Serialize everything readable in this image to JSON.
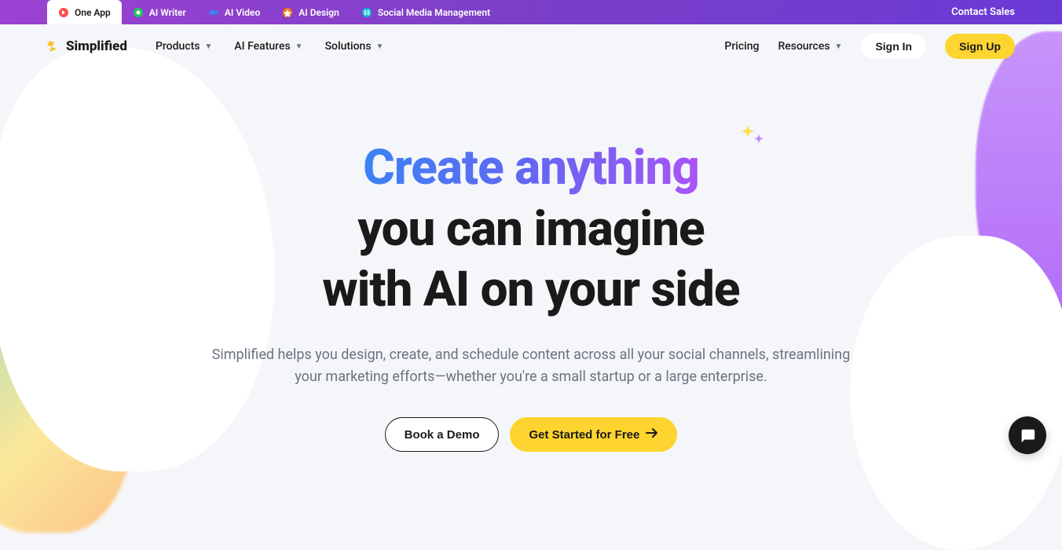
{
  "topBar": {
    "tabs": [
      {
        "icon": "oneapp",
        "label": "One App",
        "color": "#ff4d4d"
      },
      {
        "icon": "writer",
        "label": "AI Writer",
        "color": "#22c55e"
      },
      {
        "icon": "video",
        "label": "AI Video",
        "color": "#3b82f6"
      },
      {
        "icon": "design",
        "label": "AI Design",
        "color": "#f97316"
      },
      {
        "icon": "social",
        "label": "Social Media Management",
        "color": "#06b6d4"
      }
    ],
    "contactSales": "Contact Sales"
  },
  "navbar": {
    "brand": "Simplified",
    "links": [
      "Products",
      "AI Features",
      "Solutions"
    ],
    "pricing": "Pricing",
    "resources": "Resources",
    "signIn": "Sign In",
    "signUp": "Sign Up"
  },
  "hero": {
    "titleGradient": "Create anything",
    "titleLine2": "you can imagine",
    "titleLine3": "with AI on your side",
    "subtitle": "Simplified helps you design, create, and schedule content across all your social channels, streamlining your marketing efforts—whether you're a small startup or a large enterprise.",
    "ctaOutline": "Book a Demo",
    "ctaPrimary": "Get Started for Free"
  }
}
